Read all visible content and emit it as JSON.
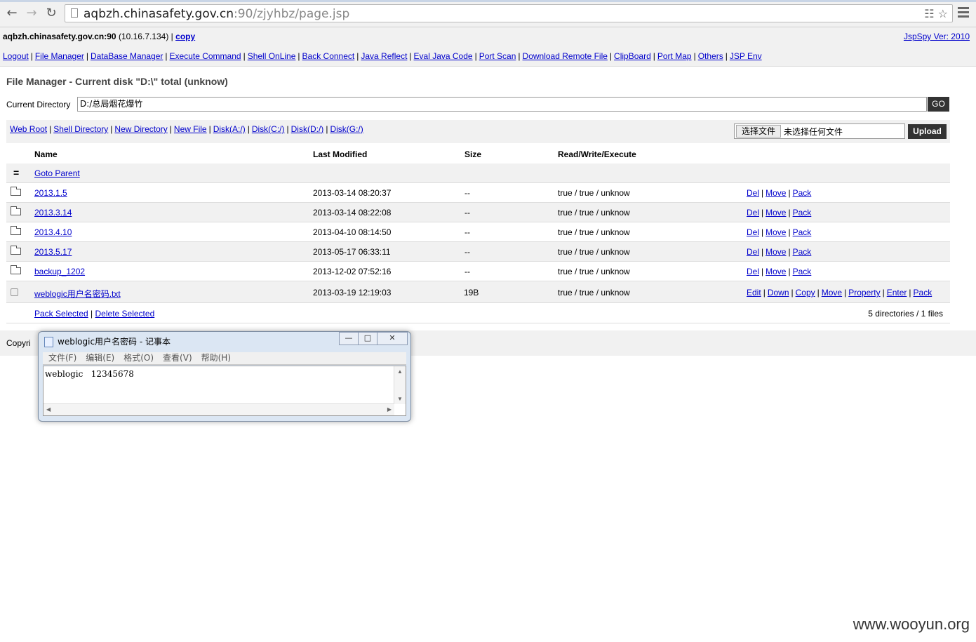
{
  "browser": {
    "url_host": "aqbzh.chinasafety.gov.cn",
    "url_rest": ":90/zjyhbz/page.jsp"
  },
  "header": {
    "host": "aqbzh.chinasafety.gov.cn:90",
    "ip": "(10.16.7.134) |",
    "copy_label": "copy",
    "version": "JspSpy Ver: 2010"
  },
  "nav": [
    "Logout",
    "File Manager",
    "DataBase Manager",
    "Execute Command",
    "Shell OnLine",
    "Back Connect",
    "Java Reflect",
    "Eval Java Code",
    "Port Scan",
    "Download Remote File",
    "ClipBoard",
    "Port Map",
    "Others",
    "JSP Env"
  ],
  "page": {
    "title": "File Manager - Current disk \"D:\\\" total (unknow)",
    "current_dir_label": "Current Directory",
    "current_dir_value": "D:/总局烟花爆竹",
    "go_label": "GO"
  },
  "toolbar": {
    "links": [
      "Web Root",
      "Shell Directory",
      "New Directory",
      "New File",
      "Disk(A:/)",
      "Disk(C:/)",
      "Disk(D:/)",
      "Disk(G:/)"
    ],
    "choose_file": "选择文件",
    "no_file": "未选择任何文件",
    "upload": "Upload"
  },
  "table": {
    "headers": {
      "name": "Name",
      "modified": "Last Modified",
      "size": "Size",
      "rwx": "Read/Write/Execute"
    },
    "parent": {
      "eq": "=",
      "label": "Goto Parent"
    },
    "rows": [
      {
        "name": "2013.1.5",
        "modified": "2013-03-14 08:20:37",
        "size": "--",
        "rwx": "true / true / unknow",
        "actions": [
          "Del",
          "Move",
          "Pack"
        ]
      },
      {
        "name": "2013.3.14",
        "modified": "2013-03-14 08:22:08",
        "size": "--",
        "rwx": "true / true / unknow",
        "actions": [
          "Del",
          "Move",
          "Pack"
        ]
      },
      {
        "name": "2013.4.10",
        "modified": "2013-04-10 08:14:50",
        "size": "--",
        "rwx": "true / true / unknow",
        "actions": [
          "Del",
          "Move",
          "Pack"
        ]
      },
      {
        "name": "2013.5.17",
        "modified": "2013-05-17 06:33:11",
        "size": "--",
        "rwx": "true / true / unknow",
        "actions": [
          "Del",
          "Move",
          "Pack"
        ]
      },
      {
        "name": "backup_1202",
        "modified": "2013-12-02 07:52:16",
        "size": "--",
        "rwx": "true / true / unknow",
        "actions": [
          "Del",
          "Move",
          "Pack"
        ]
      }
    ],
    "file_row": {
      "name": "weblogic用户名密码.txt",
      "modified": "2013-03-19 12:19:03",
      "size": "19B",
      "rwx": "true / true / unknow",
      "actions": [
        "Edit",
        "Down",
        "Copy",
        "Move",
        "Property",
        "Enter",
        "Pack"
      ]
    },
    "bottom": {
      "pack_selected": "Pack Selected",
      "delete_selected": "Delete Selected",
      "summary": "5 directories / 1 files"
    }
  },
  "footer": {
    "copyright": "Copyri"
  },
  "notepad": {
    "title": "weblogic用户名密码 - 记事本",
    "menu": [
      "文件(F)",
      "编辑(E)",
      "格式(O)",
      "查看(V)",
      "帮助(H)"
    ],
    "content": "weblogic   12345678"
  },
  "watermark": "www.wooyun.org"
}
